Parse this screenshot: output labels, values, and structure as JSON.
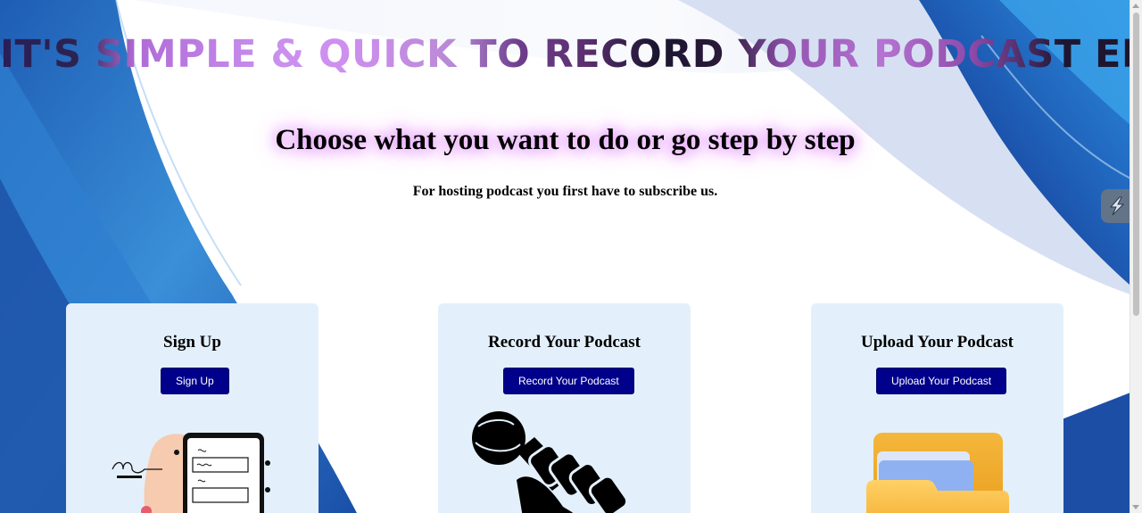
{
  "headline": "IT'S SIMPLE & QUICK TO RECORD YOUR PODCAST EPISODES",
  "subtitle": "Choose what you want to do or go step by step",
  "note": "For hosting podcast you first have to subscribe us.",
  "cards": [
    {
      "title": "Sign Up",
      "button": "Sign Up",
      "illustration": "signup-form-phone-icon"
    },
    {
      "title": "Record Your Podcast",
      "button": "Record Your Podcast",
      "illustration": "microphone-hand-icon"
    },
    {
      "title": "Upload Your Podcast",
      "button": "Upload Your Podcast",
      "illustration": "folder-icon"
    }
  ],
  "side_widget": {
    "icon": "lightning-widget-icon"
  },
  "colors": {
    "button_bg": "#00008b",
    "card_bg": "#e3f0fb",
    "bg_blue": "#2f6fc4",
    "glow": "#e08cff"
  }
}
